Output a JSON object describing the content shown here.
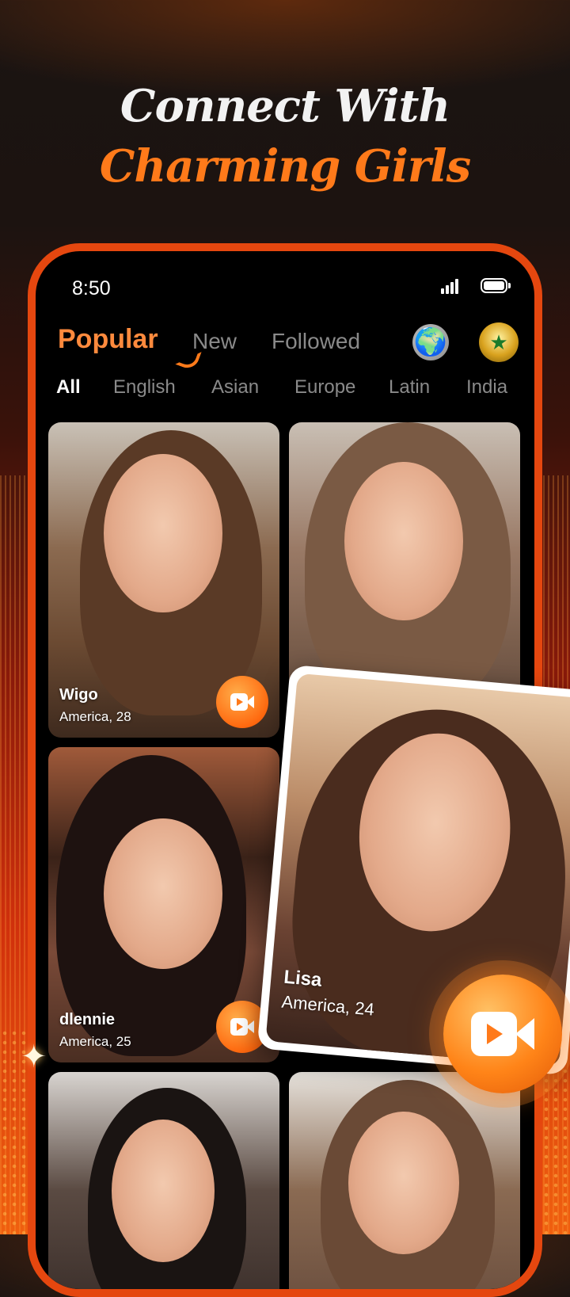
{
  "headline": {
    "line1": "Connect With",
    "line2": "Charming Girls"
  },
  "statusbar": {
    "time": "8:50"
  },
  "tabs": [
    {
      "label": "Popular"
    },
    {
      "label": "New"
    },
    {
      "label": "Followed"
    }
  ],
  "icons": {
    "globe": "globe-icon",
    "badge": "vip-badge-icon",
    "video": "video-call-icon"
  },
  "filters": [
    "All",
    "English",
    "Asian",
    "Europe",
    "Latin",
    "India"
  ],
  "cards": [
    {
      "name": "Wigo",
      "location": "America, 28"
    },
    {
      "name": "",
      "location": ""
    },
    {
      "name": "dlennie",
      "location": "America, 25"
    },
    {
      "name": "",
      "location": ""
    },
    {
      "name": "",
      "location": ""
    }
  ],
  "featured": {
    "name": "Lisa",
    "location": "America, 24"
  },
  "colors": {
    "accent": "#ff7a1a",
    "frame": "#e5470f",
    "background_top": "#1a1412"
  }
}
